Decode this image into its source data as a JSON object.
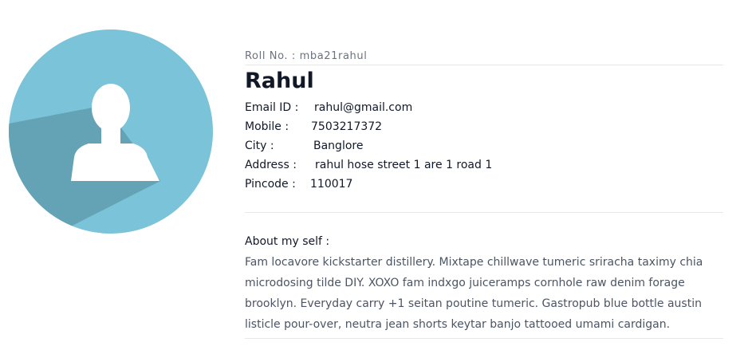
{
  "avatar": {
    "icon": "user-silhouette-icon",
    "bg_color": "#7AC3D8",
    "shadow_color": "#64A3B5"
  },
  "profile": {
    "roll_label": "Roll No. :",
    "roll_value": "mba21rahul",
    "name": "Rahul",
    "fields": [
      {
        "label": "Email ID :",
        "value": "rahul@gmail.com"
      },
      {
        "label": "Mobile :",
        "value": "7503217372"
      },
      {
        "label": "City :",
        "value": "Banglore"
      },
      {
        "label": "Address :",
        "value": "rahul hose street 1 are 1 road 1"
      },
      {
        "label": "Pincode :",
        "value": "110017"
      }
    ]
  },
  "about": {
    "title": "About my self :",
    "text": "Fam locavore kickstarter distillery. Mixtape chillwave tumeric sriracha taximy chia microdosing tilde DIY. XOXO fam indxgo juiceramps cornhole raw denim forage brooklyn. Everyday carry +1 seitan poutine tumeric. Gastropub blue bottle austin listicle pour-over, neutra jean shorts keytar banjo tattooed umami cardigan."
  }
}
